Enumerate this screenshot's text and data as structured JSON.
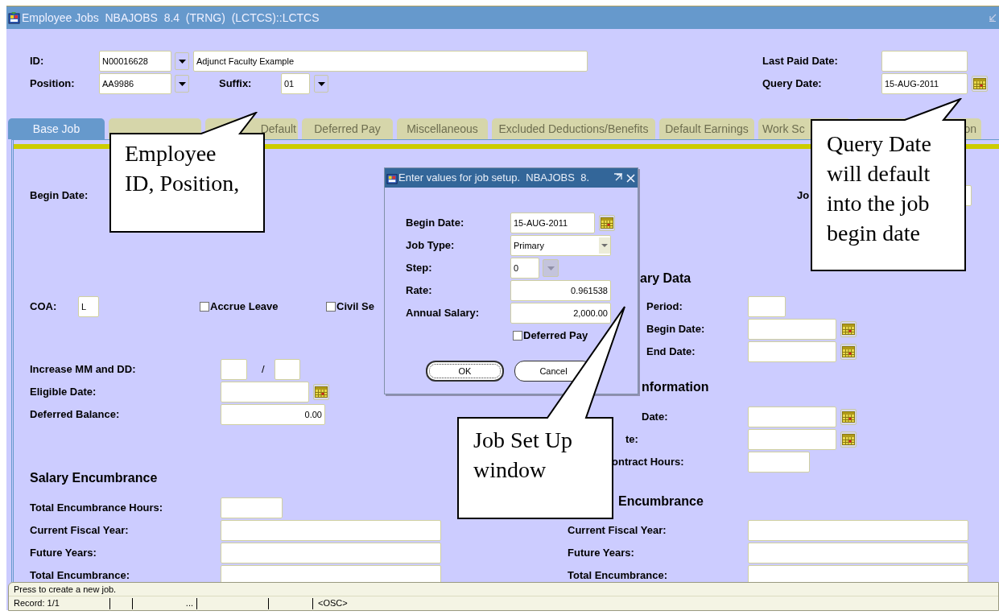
{
  "window": {
    "title": "Employee Jobs  NBAJOBS  8.4  (TRNG)  (LCTCS)::LCTCS"
  },
  "key_block": {
    "id": {
      "label": "ID:",
      "value": "N00016628",
      "name": "Adjunct Faculty Example"
    },
    "position": {
      "label": "Position:",
      "value": "AA9986"
    },
    "suffix": {
      "label": "Suffix:",
      "value": "01"
    },
    "last_paid_date": {
      "label": "Last Paid Date:"
    },
    "query_date": {
      "label": "Query Date:",
      "value": "15-AUG-2011"
    }
  },
  "tabs": [
    {
      "label": "Base Job",
      "selected": true
    },
    {
      "selected": false
    },
    {
      "label": "Default",
      "selected": false
    },
    {
      "label": "Deferred Pay",
      "selected": false
    },
    {
      "label": "Miscellaneous",
      "selected": false
    },
    {
      "label": "Excluded Deductions/Benefits",
      "selected": false
    },
    {
      "label": "Default Earnings",
      "selected": false
    },
    {
      "label": "Work Sc",
      "selected": false
    },
    {
      "label": "on",
      "selected": false
    }
  ],
  "left": [
    {
      "kind": "label",
      "label": "Begin Date:"
    },
    {
      "kind": "coa",
      "label": "COA:",
      "value": "L",
      "checks": [
        {
          "label": "Accrue Leave",
          "checked": false
        },
        {
          "label": "Civil Se",
          "checked": false
        }
      ]
    },
    {
      "kind": "mmdd",
      "label": "Increase MM and DD:",
      "separator": "/"
    },
    {
      "kind": "date",
      "label": "Eligible Date:"
    },
    {
      "kind": "number",
      "label": "Deferred Balance:",
      "value": "0.00"
    },
    {
      "kind": "heading",
      "label": "Salary Encumbrance"
    },
    {
      "kind": "medium",
      "label": "Total Encumbrance Hours:"
    },
    {
      "kind": "wide",
      "label": "Current Fiscal Year:"
    },
    {
      "kind": "wide",
      "label": "Future Years:"
    },
    {
      "kind": "wide",
      "label": "Total Encumbrance:"
    }
  ],
  "right": [
    {
      "kind": "stub",
      "label": "Jo"
    },
    {
      "kind": "heading",
      "label": "ary Data"
    },
    {
      "kind": "short",
      "label": "Period:"
    },
    {
      "kind": "date",
      "label": "Begin Date:"
    },
    {
      "kind": "date",
      "label": "End Date:"
    },
    {
      "kind": "heading",
      "label": "nformation"
    },
    {
      "kind": "date",
      "label": "Date:"
    },
    {
      "kind": "date",
      "label": "te:"
    },
    {
      "kind": "medium",
      "label": "ontract Hours:"
    },
    {
      "kind": "heading",
      "label": "Encumbrance"
    },
    {
      "kind": "wide",
      "label": "Current Fiscal Year:"
    },
    {
      "kind": "wide",
      "label": "Future Years:"
    },
    {
      "kind": "wide",
      "label": "Total Encumbrance:"
    }
  ],
  "dialog": {
    "title": "Enter values for job setup.  NBAJOBS  8.",
    "fields": [
      {
        "kind": "date",
        "label": "Begin Date:",
        "value": "15-AUG-2011"
      },
      {
        "kind": "select",
        "label": "Job Type:",
        "value": "Primary"
      },
      {
        "kind": "lov",
        "label": "Step:",
        "value": "0"
      },
      {
        "kind": "number",
        "label": "Rate:",
        "value": "0.961538"
      },
      {
        "kind": "number",
        "label": "Annual Salary:",
        "value": "2,000.00"
      }
    ],
    "checkbox": {
      "label": "Deferred Pay",
      "checked": false
    },
    "buttons": [
      {
        "label": "OK",
        "focused": true
      },
      {
        "label": "Cancel",
        "focused": false
      }
    ]
  },
  "callouts": [
    {
      "text": "Employee ID, Position,"
    },
    {
      "text": "Query Date will default into the job begin date"
    },
    {
      "text": "Job Set Up window"
    }
  ],
  "status_bar": {
    "message": "Press to create a new job.",
    "record": "Record: 1/1",
    "cells": [
      "",
      "",
      "...",
      "",
      "",
      "<OSC>"
    ]
  }
}
